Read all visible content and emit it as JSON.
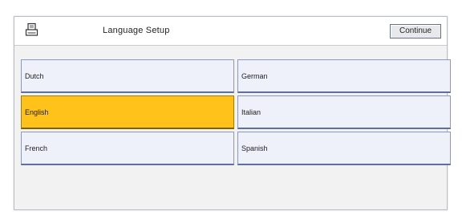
{
  "header": {
    "title": "Language Setup",
    "continue_label": "Continue",
    "icon": "printer-icon"
  },
  "languages": [
    {
      "label": "Dutch",
      "selected": false
    },
    {
      "label": "German",
      "selected": false
    },
    {
      "label": "English",
      "selected": true
    },
    {
      "label": "Italian",
      "selected": false
    },
    {
      "label": "French",
      "selected": false
    },
    {
      "label": "Spanish",
      "selected": false
    }
  ],
  "colors": {
    "selected": "#ffc21a",
    "button": "#eef0fa",
    "button_border": "#5f6f9e"
  }
}
